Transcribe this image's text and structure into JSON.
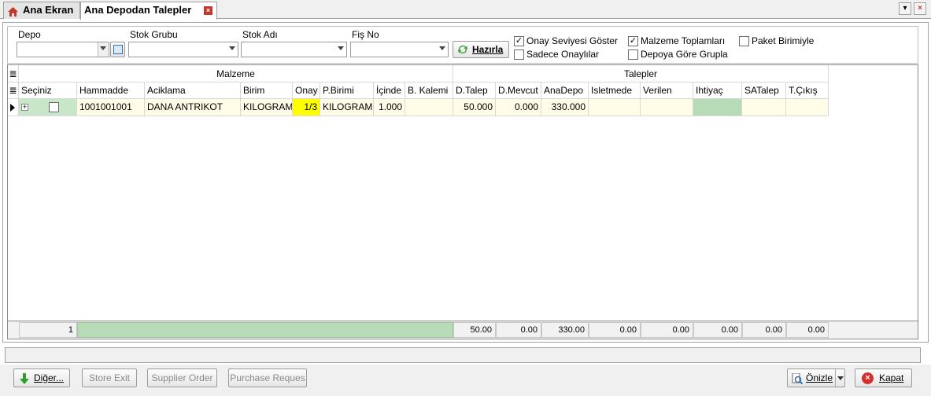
{
  "tabs": [
    {
      "label": "Ana Ekran",
      "icon": "home-icon"
    },
    {
      "label": "Ana Depodan Talepler",
      "icon": "close-icon"
    }
  ],
  "filters": {
    "depo_label": "Depo",
    "stok_grubu_label": "Stok Grubu",
    "stok_adi_label": "Stok Adı",
    "fis_no_label": "Fiş No",
    "depo_value": "",
    "stok_grubu_value": "",
    "stok_adi_value": "",
    "fis_no_value": ""
  },
  "toolbar": {
    "hazirla_label": "Hazırla"
  },
  "options": [
    {
      "label": "Onay Seviyesi Göster",
      "checked": true
    },
    {
      "label": "Sadece Onaylılar",
      "checked": false
    },
    {
      "label": "Malzeme Toplamları",
      "checked": true
    },
    {
      "label": "Depoya Göre Grupla",
      "checked": false
    },
    {
      "label": "Paket Birimiyle",
      "checked": false
    }
  ],
  "grid": {
    "bands": [
      "Malzeme",
      "Talepler"
    ],
    "columns": [
      "Seçiniz",
      "Hammadde",
      "Aciklama",
      "Birim",
      "Onay",
      "P.Birimi",
      "İçinde",
      "B. Kalemi",
      "D.Talep",
      "D.Mevcut",
      "AnaDepo",
      "Isletmede",
      "Verilen",
      "Ihtiyaç",
      "SATalep",
      "T.Çıkış"
    ],
    "rows": [
      {
        "seciniz": false,
        "hammadde": "1001001001",
        "aciklama": "DANA ANTRIKOT",
        "birim": "KILOGRAM",
        "onay": "1/3",
        "p_birimi": "KILOGRAM",
        "icinde": "1.000",
        "b_kalemi": "",
        "d_talep": "50.000",
        "d_mevcut": "0.000",
        "anadepo": "330.000",
        "isletmede": "",
        "verilen": "",
        "ihtiyac": "",
        "satalep": "",
        "t_cikis": ""
      }
    ],
    "footer": {
      "count": "1",
      "d_talep": "50.00",
      "d_mevcut": "0.00",
      "anadepo": "330.00",
      "isletmede": "0.00",
      "verilen": "0.00",
      "ihtiyac": "0.00",
      "satalep": "0.00",
      "t_cikis": "0.00"
    }
  },
  "bottom": {
    "diger_label": "Diğer...",
    "store_exit_label": "Store Exit",
    "supplier_order_label": "Supplier Order",
    "purchase_request_label": "Purchase Reques",
    "onizle_label": "Önizle",
    "kapat_label": "Kapat"
  },
  "colors": {
    "onay_highlight": "#ffff00",
    "row_background": "#fffde7",
    "footer_bar": "#b7dbb7",
    "ihtiyac_cell": "#b7dbb7"
  }
}
